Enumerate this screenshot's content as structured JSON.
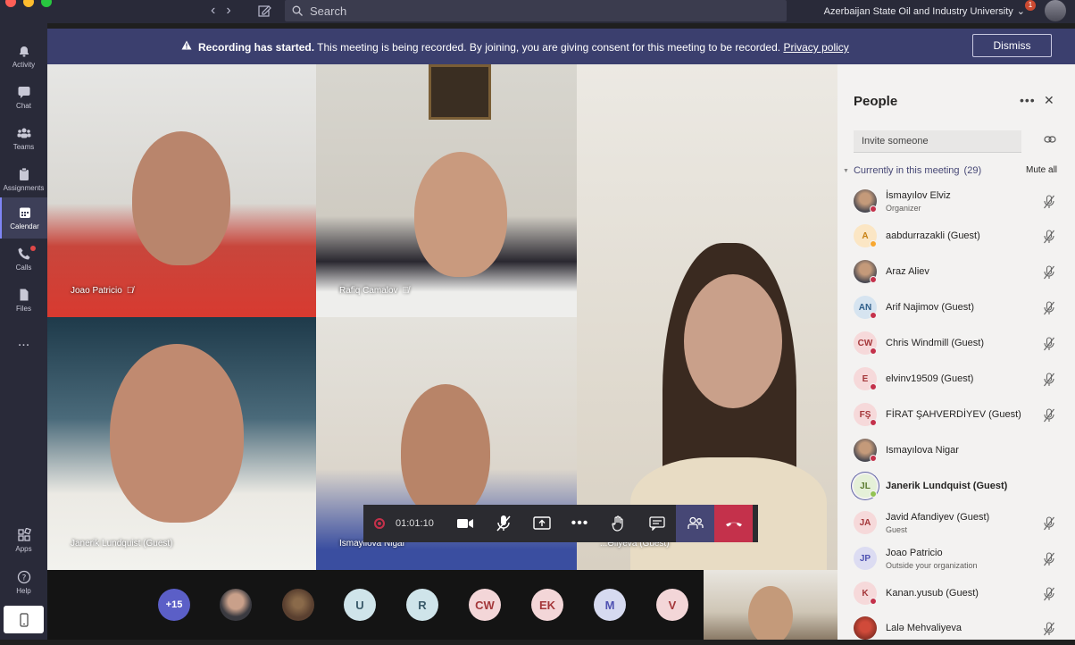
{
  "titlebar": {
    "search_placeholder": "Search",
    "org_name": "Azerbaijan State Oil and Industry University",
    "notification_count": "1"
  },
  "rail": [
    {
      "label": "Activity",
      "icon": "bell-icon"
    },
    {
      "label": "Chat",
      "icon": "chat-icon"
    },
    {
      "label": "Teams",
      "icon": "teams-icon"
    },
    {
      "label": "Assignments",
      "icon": "assignments-icon"
    },
    {
      "label": "Calendar",
      "icon": "calendar-icon",
      "active": true
    },
    {
      "label": "Calls",
      "icon": "phone-icon",
      "dot": true
    },
    {
      "label": "Files",
      "icon": "file-icon"
    },
    {
      "label": "...",
      "icon": "more-icon"
    },
    {
      "label": "Apps",
      "icon": "apps-icon"
    },
    {
      "label": "Help",
      "icon": "help-icon"
    }
  ],
  "banner": {
    "strong": "Recording has started.",
    "text": " This meeting is being recorded. By joining, you are giving consent for this meeting to be recorded. ",
    "link": "Privacy policy",
    "dismiss": "Dismiss"
  },
  "tiles": [
    {
      "name": "Joao Patricio"
    },
    {
      "name": "Rafiq Camalov"
    },
    {
      "name": "Janerik Lundquist (Guest)"
    },
    {
      "name": "Ismayilova Nigar"
    },
    {
      "name": "...Əliyeva (Guest)"
    }
  ],
  "controls": {
    "timer": "01:01:10"
  },
  "strip": [
    {
      "label": "+15",
      "bg": "#5b5fc7",
      "fg": "#ffffff"
    },
    {
      "label": "",
      "photo": true
    },
    {
      "label": "",
      "photo": true
    },
    {
      "label": "U",
      "bg": "#cfe4ea",
      "fg": "#3a5a6a"
    },
    {
      "label": "R",
      "bg": "#cfe4ea",
      "fg": "#3a5a6a"
    },
    {
      "label": "CW",
      "bg": "#f3d6d8",
      "fg": "#a4373a"
    },
    {
      "label": "EK",
      "bg": "#f3d6d8",
      "fg": "#a4373a"
    },
    {
      "label": "M",
      "bg": "#d6daf0",
      "fg": "#4f52b2"
    },
    {
      "label": "V",
      "bg": "#f3d6d8",
      "fg": "#a4373a"
    }
  ],
  "panel": {
    "title": "People",
    "invite_placeholder": "Invite someone",
    "section_label": "Currently in this meeting",
    "section_count": "(29)",
    "mute_all": "Mute all",
    "people": [
      {
        "name": "İsmayılov Elviz",
        "sub": "Organizer",
        "initials": "",
        "photo": true,
        "status": "#c4314b",
        "mic": true
      },
      {
        "name": "aabdurrazakli (Guest)",
        "sub": "",
        "initials": "A",
        "bg": "#fbe6c4",
        "fg": "#c77f10",
        "status": "#f8a72e",
        "mic": true
      },
      {
        "name": "Araz Aliev",
        "sub": "",
        "initials": "",
        "photo": true,
        "status": "#c4314b",
        "mic": true
      },
      {
        "name": "Arif Najimov (Guest)",
        "sub": "",
        "initials": "AN",
        "bg": "#d6e4f0",
        "fg": "#2e5e8a",
        "status": "#c4314b",
        "mic": true
      },
      {
        "name": "Chris Windmill (Guest)",
        "sub": "",
        "initials": "CW",
        "bg": "#f6d9da",
        "fg": "#a4373a",
        "status": "#c4314b",
        "mic": true
      },
      {
        "name": "elvinv19509 (Guest)",
        "sub": "",
        "initials": "E",
        "bg": "#f6d9da",
        "fg": "#a4373a",
        "status": "#c4314b",
        "mic": true
      },
      {
        "name": "FİRAT ŞAHVERDİYEV (Guest)",
        "sub": "",
        "initials": "FŞ",
        "bg": "#f6d9da",
        "fg": "#a4373a",
        "status": "#c4314b",
        "mic": true
      },
      {
        "name": "Ismayılova Nigar",
        "sub": "",
        "initials": "",
        "photo": true,
        "status": "#c4314b",
        "mic": false
      },
      {
        "name": "Janerik Lundquist (Guest)",
        "sub": "",
        "initials": "JL",
        "bg": "#e5f0d8",
        "fg": "#5a7a2e",
        "status": "#92c353",
        "mic": false,
        "bold": true,
        "ring": true
      },
      {
        "name": "Javid Afandiyev (Guest)",
        "sub": "Guest",
        "initials": "JA",
        "bg": "#f6d9da",
        "fg": "#a4373a",
        "status": "",
        "mic": true
      },
      {
        "name": "Joao Patricio",
        "sub": "Outside your organization",
        "initials": "JP",
        "bg": "#dcdcf2",
        "fg": "#4f52b2",
        "status": "",
        "mic": true
      },
      {
        "name": "Kanan.yusub (Guest)",
        "sub": "",
        "initials": "K",
        "bg": "#f6d9da",
        "fg": "#a4373a",
        "status": "#c4314b",
        "mic": true
      },
      {
        "name": "Lalə Mehvaliyeva",
        "sub": "",
        "initials": "",
        "photo": true,
        "photo_red": true,
        "status": "",
        "mic": true
      }
    ]
  }
}
